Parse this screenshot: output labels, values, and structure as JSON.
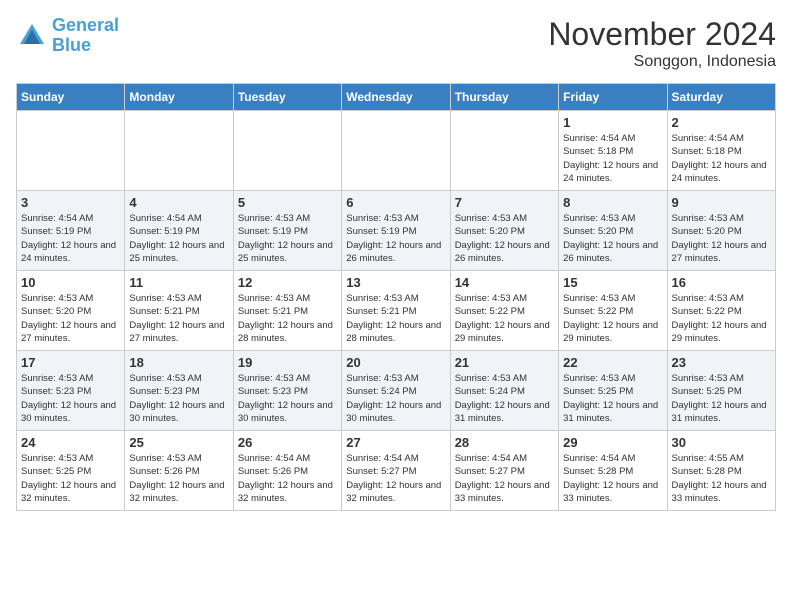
{
  "logo": {
    "line1": "General",
    "line2": "Blue"
  },
  "title": "November 2024",
  "location": "Songgon, Indonesia",
  "days_of_week": [
    "Sunday",
    "Monday",
    "Tuesday",
    "Wednesday",
    "Thursday",
    "Friday",
    "Saturday"
  ],
  "weeks": [
    [
      {
        "num": "",
        "detail": ""
      },
      {
        "num": "",
        "detail": ""
      },
      {
        "num": "",
        "detail": ""
      },
      {
        "num": "",
        "detail": ""
      },
      {
        "num": "",
        "detail": ""
      },
      {
        "num": "1",
        "detail": "Sunrise: 4:54 AM\nSunset: 5:18 PM\nDaylight: 12 hours and 24 minutes."
      },
      {
        "num": "2",
        "detail": "Sunrise: 4:54 AM\nSunset: 5:18 PM\nDaylight: 12 hours and 24 minutes."
      }
    ],
    [
      {
        "num": "3",
        "detail": "Sunrise: 4:54 AM\nSunset: 5:19 PM\nDaylight: 12 hours and 24 minutes."
      },
      {
        "num": "4",
        "detail": "Sunrise: 4:54 AM\nSunset: 5:19 PM\nDaylight: 12 hours and 25 minutes."
      },
      {
        "num": "5",
        "detail": "Sunrise: 4:53 AM\nSunset: 5:19 PM\nDaylight: 12 hours and 25 minutes."
      },
      {
        "num": "6",
        "detail": "Sunrise: 4:53 AM\nSunset: 5:19 PM\nDaylight: 12 hours and 26 minutes."
      },
      {
        "num": "7",
        "detail": "Sunrise: 4:53 AM\nSunset: 5:20 PM\nDaylight: 12 hours and 26 minutes."
      },
      {
        "num": "8",
        "detail": "Sunrise: 4:53 AM\nSunset: 5:20 PM\nDaylight: 12 hours and 26 minutes."
      },
      {
        "num": "9",
        "detail": "Sunrise: 4:53 AM\nSunset: 5:20 PM\nDaylight: 12 hours and 27 minutes."
      }
    ],
    [
      {
        "num": "10",
        "detail": "Sunrise: 4:53 AM\nSunset: 5:20 PM\nDaylight: 12 hours and 27 minutes."
      },
      {
        "num": "11",
        "detail": "Sunrise: 4:53 AM\nSunset: 5:21 PM\nDaylight: 12 hours and 27 minutes."
      },
      {
        "num": "12",
        "detail": "Sunrise: 4:53 AM\nSunset: 5:21 PM\nDaylight: 12 hours and 28 minutes."
      },
      {
        "num": "13",
        "detail": "Sunrise: 4:53 AM\nSunset: 5:21 PM\nDaylight: 12 hours and 28 minutes."
      },
      {
        "num": "14",
        "detail": "Sunrise: 4:53 AM\nSunset: 5:22 PM\nDaylight: 12 hours and 29 minutes."
      },
      {
        "num": "15",
        "detail": "Sunrise: 4:53 AM\nSunset: 5:22 PM\nDaylight: 12 hours and 29 minutes."
      },
      {
        "num": "16",
        "detail": "Sunrise: 4:53 AM\nSunset: 5:22 PM\nDaylight: 12 hours and 29 minutes."
      }
    ],
    [
      {
        "num": "17",
        "detail": "Sunrise: 4:53 AM\nSunset: 5:23 PM\nDaylight: 12 hours and 30 minutes."
      },
      {
        "num": "18",
        "detail": "Sunrise: 4:53 AM\nSunset: 5:23 PM\nDaylight: 12 hours and 30 minutes."
      },
      {
        "num": "19",
        "detail": "Sunrise: 4:53 AM\nSunset: 5:23 PM\nDaylight: 12 hours and 30 minutes."
      },
      {
        "num": "20",
        "detail": "Sunrise: 4:53 AM\nSunset: 5:24 PM\nDaylight: 12 hours and 30 minutes."
      },
      {
        "num": "21",
        "detail": "Sunrise: 4:53 AM\nSunset: 5:24 PM\nDaylight: 12 hours and 31 minutes."
      },
      {
        "num": "22",
        "detail": "Sunrise: 4:53 AM\nSunset: 5:25 PM\nDaylight: 12 hours and 31 minutes."
      },
      {
        "num": "23",
        "detail": "Sunrise: 4:53 AM\nSunset: 5:25 PM\nDaylight: 12 hours and 31 minutes."
      }
    ],
    [
      {
        "num": "24",
        "detail": "Sunrise: 4:53 AM\nSunset: 5:25 PM\nDaylight: 12 hours and 32 minutes."
      },
      {
        "num": "25",
        "detail": "Sunrise: 4:53 AM\nSunset: 5:26 PM\nDaylight: 12 hours and 32 minutes."
      },
      {
        "num": "26",
        "detail": "Sunrise: 4:54 AM\nSunset: 5:26 PM\nDaylight: 12 hours and 32 minutes."
      },
      {
        "num": "27",
        "detail": "Sunrise: 4:54 AM\nSunset: 5:27 PM\nDaylight: 12 hours and 32 minutes."
      },
      {
        "num": "28",
        "detail": "Sunrise: 4:54 AM\nSunset: 5:27 PM\nDaylight: 12 hours and 33 minutes."
      },
      {
        "num": "29",
        "detail": "Sunrise: 4:54 AM\nSunset: 5:28 PM\nDaylight: 12 hours and 33 minutes."
      },
      {
        "num": "30",
        "detail": "Sunrise: 4:55 AM\nSunset: 5:28 PM\nDaylight: 12 hours and 33 minutes."
      }
    ]
  ]
}
